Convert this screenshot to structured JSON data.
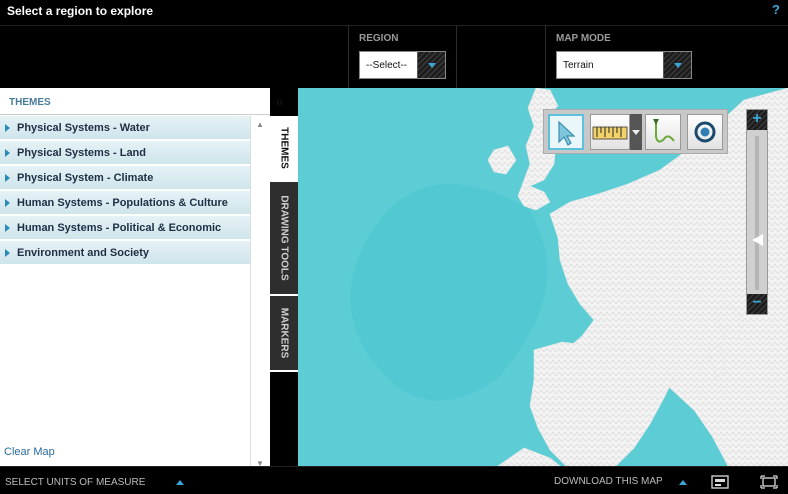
{
  "header": {
    "title": "Select a region to explore",
    "help_label": "?"
  },
  "controls": {
    "region": {
      "label": "REGION",
      "value": "--Select--"
    },
    "map_mode": {
      "label": "MAP MODE",
      "value": "Terrain"
    }
  },
  "left_panel": {
    "heading": "THEMES",
    "collapse_label": "«",
    "themes": [
      "Physical Systems - Water",
      "Physical Systems - Land",
      "Physical System - Climate",
      "Human Systems - Populations & Culture",
      "Human Systems - Political & Economic",
      "Environment and Society"
    ],
    "clear_map_label": "Clear Map"
  },
  "side_tabs": [
    {
      "label": "THEMES",
      "active": true
    },
    {
      "label": "DRAWING TOOLS",
      "active": false
    },
    {
      "label": "MARKERS",
      "active": false
    }
  ],
  "map_tools": {
    "tools": [
      "select-pointer",
      "measure-ruler",
      "draw-path",
      "marker-point"
    ]
  },
  "footer": {
    "units_label": "SELECT UNITS OF MEASURE",
    "download_label": "DOWNLOAD THIS MAP"
  },
  "colors": {
    "accent": "#3aa6d8",
    "theme_text": "#1e2e44",
    "ocean": "#52c9d2",
    "land": "#f4f4f4"
  }
}
